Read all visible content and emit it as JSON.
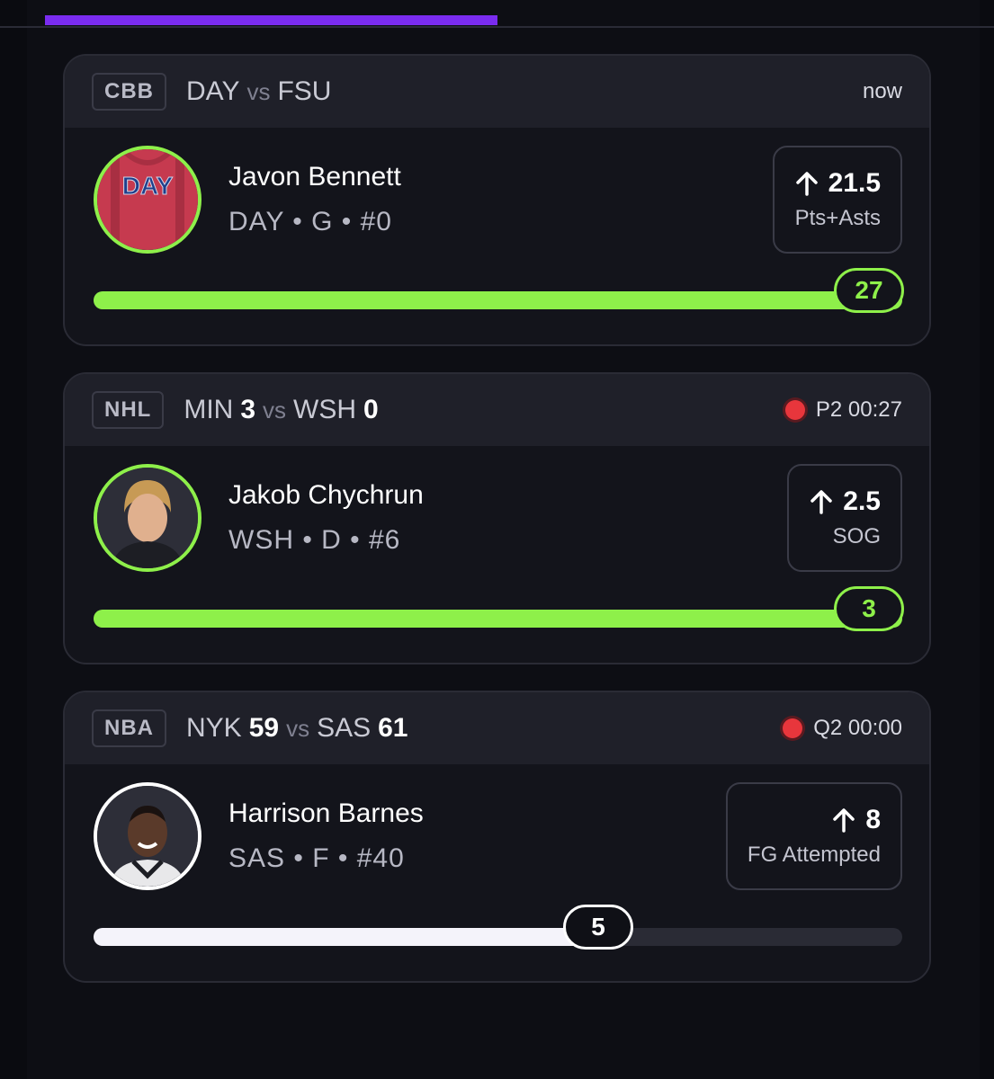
{
  "cards": [
    {
      "league": "CBB",
      "home": "DAY",
      "home_score": "",
      "vs": "vs",
      "away": "FSU",
      "away_score": "",
      "status": "now",
      "live": false,
      "player": {
        "name": "Javon Bennett",
        "meta": "DAY • G • #0",
        "avatar_icon": "jersey-icon",
        "jersey_text": "DAY"
      },
      "line": {
        "value": "21.5",
        "stat": "Pts+Asts",
        "direction": "up-arrow-icon"
      },
      "progress": {
        "current": "27",
        "fraction": 1.0,
        "color": "#8ef04a"
      }
    },
    {
      "league": "NHL",
      "home": "MIN",
      "home_score": "3",
      "vs": "vs",
      "away": "WSH",
      "away_score": "0",
      "status": "P2 00:27",
      "live": true,
      "player": {
        "name": "Jakob Chychrun",
        "meta": "WSH • D • #6",
        "avatar_icon": "player-headshot-icon"
      },
      "line": {
        "value": "2.5",
        "stat": "SOG",
        "direction": "up-arrow-icon"
      },
      "progress": {
        "current": "3",
        "fraction": 1.0,
        "color": "#8ef04a"
      }
    },
    {
      "league": "NBA",
      "home": "NYK",
      "home_score": "59",
      "vs": "vs",
      "away": "SAS",
      "away_score": "61",
      "status": "Q2 00:00",
      "live": true,
      "player": {
        "name": "Harrison Barnes",
        "meta": "SAS • F • #40",
        "avatar_icon": "player-headshot-icon"
      },
      "line": {
        "value": "8",
        "stat": "FG Attempted",
        "direction": "up-arrow-icon"
      },
      "progress": {
        "current": "5",
        "fraction": 0.625,
        "color": "#f4f3fa"
      }
    }
  ],
  "colors": {
    "accent_tab": "#7a2cf0",
    "hit": "#8ef04a",
    "live": "#e8363c"
  }
}
